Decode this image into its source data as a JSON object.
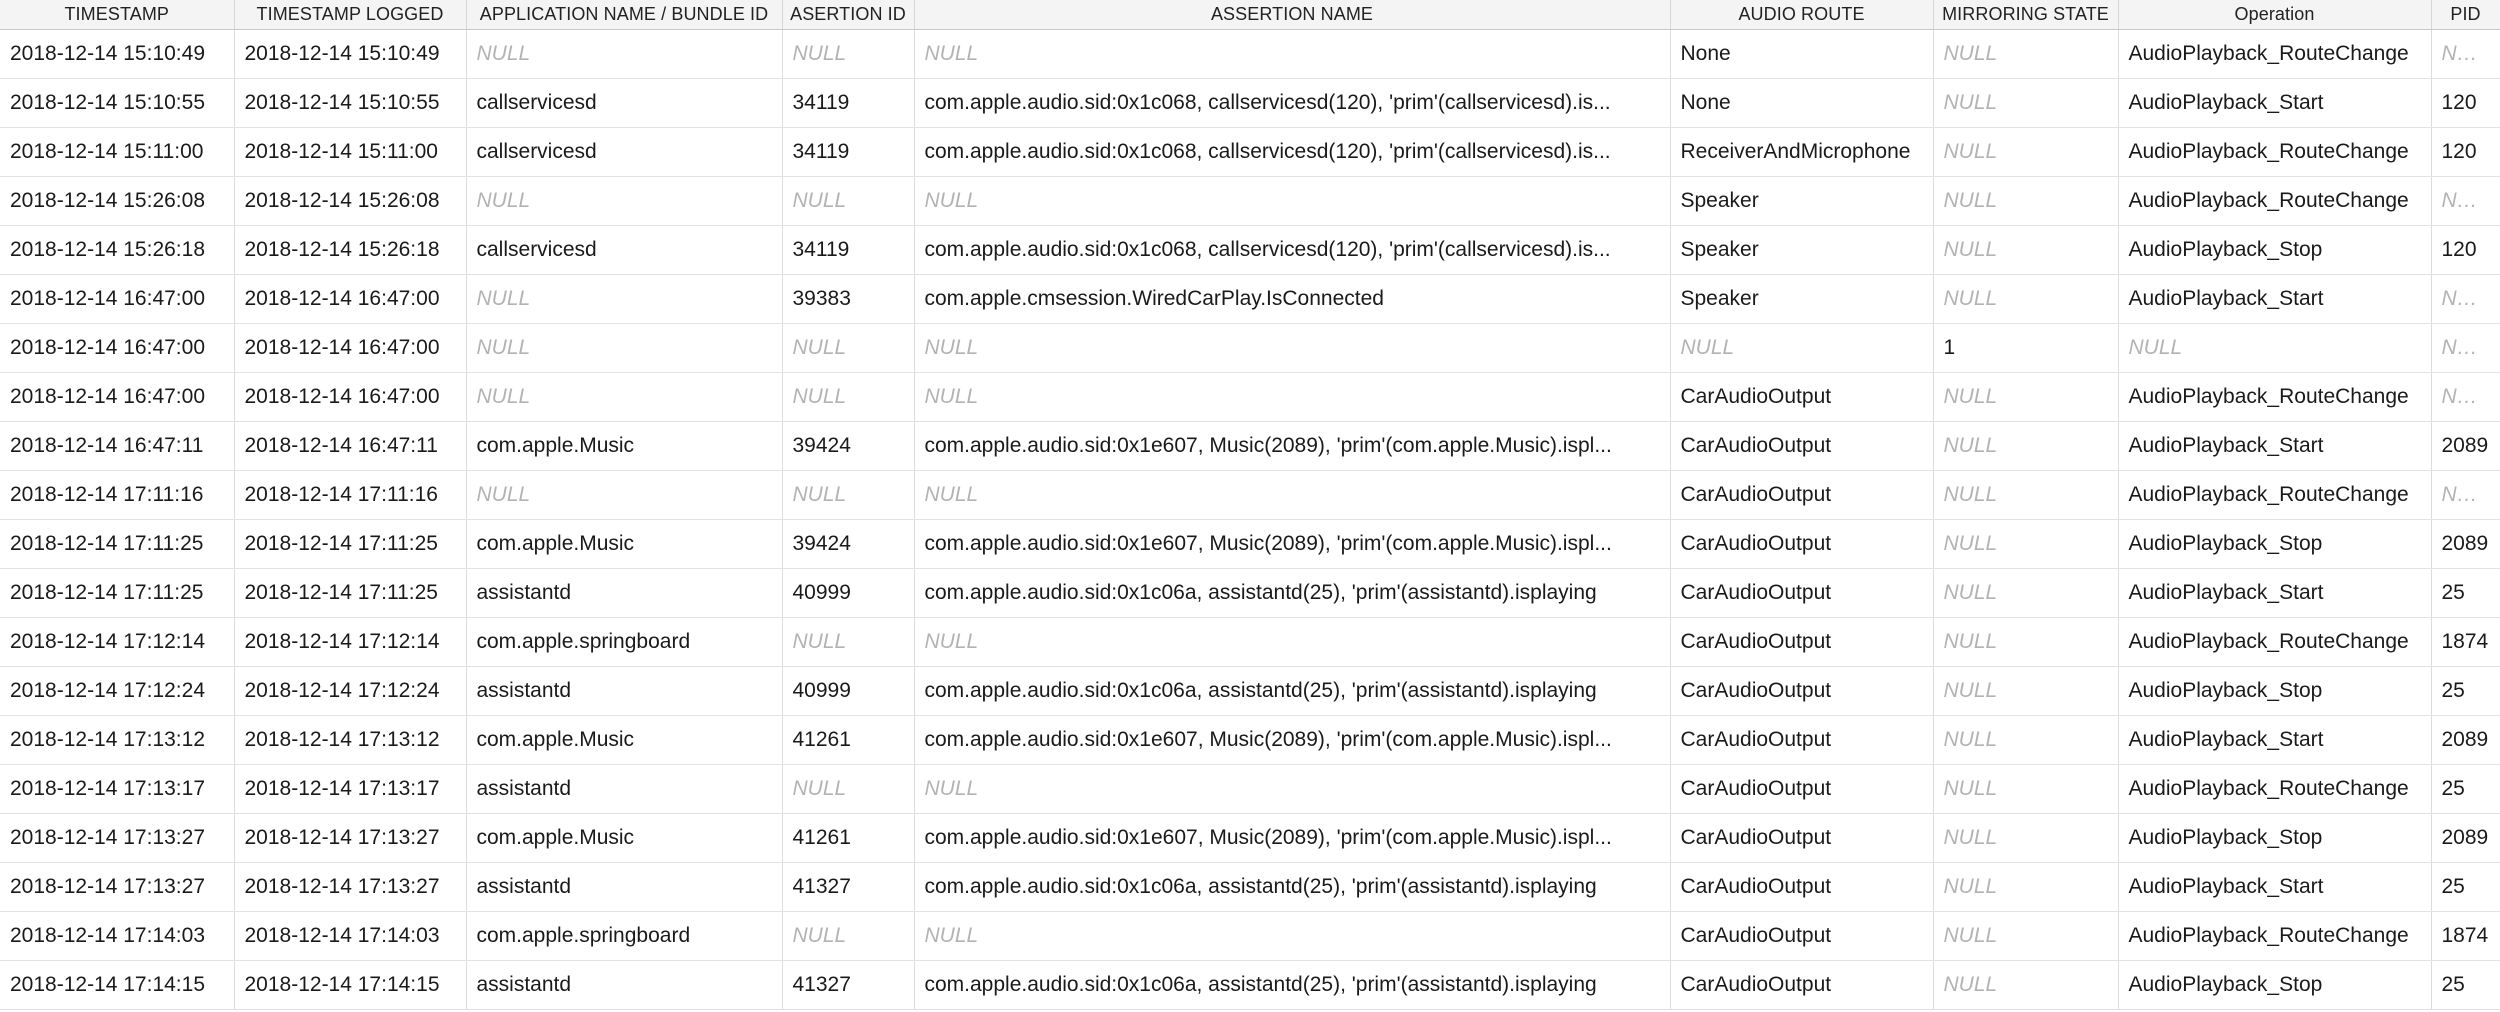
{
  "table": {
    "columns": [
      "TIMESTAMP",
      "TIMESTAMP LOGGED",
      "APPLICATION NAME / BUNDLE ID",
      "ASERTION ID",
      "ASSERTION NAME",
      "AUDIO ROUTE",
      "MIRRORING STATE",
      "Operation",
      "PID"
    ],
    "null_text": "NULL",
    "rows": [
      [
        "2018-12-14 15:10:49",
        "2018-12-14 15:10:49",
        "NULL",
        "NULL",
        "NULL",
        "None",
        "NULL",
        "AudioPlayback_RouteChange",
        "NULL"
      ],
      [
        "2018-12-14 15:10:55",
        "2018-12-14 15:10:55",
        "callservicesd",
        "34119",
        "com.apple.audio.sid:0x1c068, callservicesd(120), 'prim'(callservicesd).is...",
        "None",
        "NULL",
        "AudioPlayback_Start",
        "120"
      ],
      [
        "2018-12-14 15:11:00",
        "2018-12-14 15:11:00",
        "callservicesd",
        "34119",
        "com.apple.audio.sid:0x1c068, callservicesd(120), 'prim'(callservicesd).is...",
        "ReceiverAndMicrophone",
        "NULL",
        "AudioPlayback_RouteChange",
        "120"
      ],
      [
        "2018-12-14 15:26:08",
        "2018-12-14 15:26:08",
        "NULL",
        "NULL",
        "NULL",
        "Speaker",
        "NULL",
        "AudioPlayback_RouteChange",
        "NULL"
      ],
      [
        "2018-12-14 15:26:18",
        "2018-12-14 15:26:18",
        "callservicesd",
        "34119",
        "com.apple.audio.sid:0x1c068, callservicesd(120), 'prim'(callservicesd).is...",
        "Speaker",
        "NULL",
        "AudioPlayback_Stop",
        "120"
      ],
      [
        "2018-12-14 16:47:00",
        "2018-12-14 16:47:00",
        "NULL",
        "39383",
        "com.apple.cmsession.WiredCarPlay.IsConnected",
        "Speaker",
        "NULL",
        "AudioPlayback_Start",
        "NULL"
      ],
      [
        "2018-12-14 16:47:00",
        "2018-12-14 16:47:00",
        "NULL",
        "NULL",
        "NULL",
        "NULL",
        "1",
        "NULL",
        "NULL"
      ],
      [
        "2018-12-14 16:47:00",
        "2018-12-14 16:47:00",
        "NULL",
        "NULL",
        "NULL",
        "CarAudioOutput",
        "NULL",
        "AudioPlayback_RouteChange",
        "NULL"
      ],
      [
        "2018-12-14 16:47:11",
        "2018-12-14 16:47:11",
        "com.apple.Music",
        "39424",
        "com.apple.audio.sid:0x1e607, Music(2089), 'prim'(com.apple.Music).ispl...",
        "CarAudioOutput",
        "NULL",
        "AudioPlayback_Start",
        "2089"
      ],
      [
        "2018-12-14 17:11:16",
        "2018-12-14 17:11:16",
        "NULL",
        "NULL",
        "NULL",
        "CarAudioOutput",
        "NULL",
        "AudioPlayback_RouteChange",
        "NULL"
      ],
      [
        "2018-12-14 17:11:25",
        "2018-12-14 17:11:25",
        "com.apple.Music",
        "39424",
        "com.apple.audio.sid:0x1e607, Music(2089), 'prim'(com.apple.Music).ispl...",
        "CarAudioOutput",
        "NULL",
        "AudioPlayback_Stop",
        "2089"
      ],
      [
        "2018-12-14 17:11:25",
        "2018-12-14 17:11:25",
        "assistantd",
        "40999",
        "com.apple.audio.sid:0x1c06a, assistantd(25), 'prim'(assistantd).isplaying",
        "CarAudioOutput",
        "NULL",
        "AudioPlayback_Start",
        "25"
      ],
      [
        "2018-12-14 17:12:14",
        "2018-12-14 17:12:14",
        "com.apple.springboard",
        "NULL",
        "NULL",
        "CarAudioOutput",
        "NULL",
        "AudioPlayback_RouteChange",
        "1874"
      ],
      [
        "2018-12-14 17:12:24",
        "2018-12-14 17:12:24",
        "assistantd",
        "40999",
        "com.apple.audio.sid:0x1c06a, assistantd(25), 'prim'(assistantd).isplaying",
        "CarAudioOutput",
        "NULL",
        "AudioPlayback_Stop",
        "25"
      ],
      [
        "2018-12-14 17:13:12",
        "2018-12-14 17:13:12",
        "com.apple.Music",
        "41261",
        "com.apple.audio.sid:0x1e607, Music(2089), 'prim'(com.apple.Music).ispl...",
        "CarAudioOutput",
        "NULL",
        "AudioPlayback_Start",
        "2089"
      ],
      [
        "2018-12-14 17:13:17",
        "2018-12-14 17:13:17",
        "assistantd",
        "NULL",
        "NULL",
        "CarAudioOutput",
        "NULL",
        "AudioPlayback_RouteChange",
        "25"
      ],
      [
        "2018-12-14 17:13:27",
        "2018-12-14 17:13:27",
        "com.apple.Music",
        "41261",
        "com.apple.audio.sid:0x1e607, Music(2089), 'prim'(com.apple.Music).ispl...",
        "CarAudioOutput",
        "NULL",
        "AudioPlayback_Stop",
        "2089"
      ],
      [
        "2018-12-14 17:13:27",
        "2018-12-14 17:13:27",
        "assistantd",
        "41327",
        "com.apple.audio.sid:0x1c06a, assistantd(25), 'prim'(assistantd).isplaying",
        "CarAudioOutput",
        "NULL",
        "AudioPlayback_Start",
        "25"
      ],
      [
        "2018-12-14 17:14:03",
        "2018-12-14 17:14:03",
        "com.apple.springboard",
        "NULL",
        "NULL",
        "CarAudioOutput",
        "NULL",
        "AudioPlayback_RouteChange",
        "1874"
      ],
      [
        "2018-12-14 17:14:15",
        "2018-12-14 17:14:15",
        "assistantd",
        "41327",
        "com.apple.audio.sid:0x1c06a, assistantd(25), 'prim'(assistantd).isplaying",
        "CarAudioOutput",
        "NULL",
        "AudioPlayback_Stop",
        "25"
      ]
    ]
  },
  "colors": {
    "header_bg": "#f4f4f4",
    "null_text": "#b3b3b3",
    "grid_line": "#dcdcdc"
  }
}
